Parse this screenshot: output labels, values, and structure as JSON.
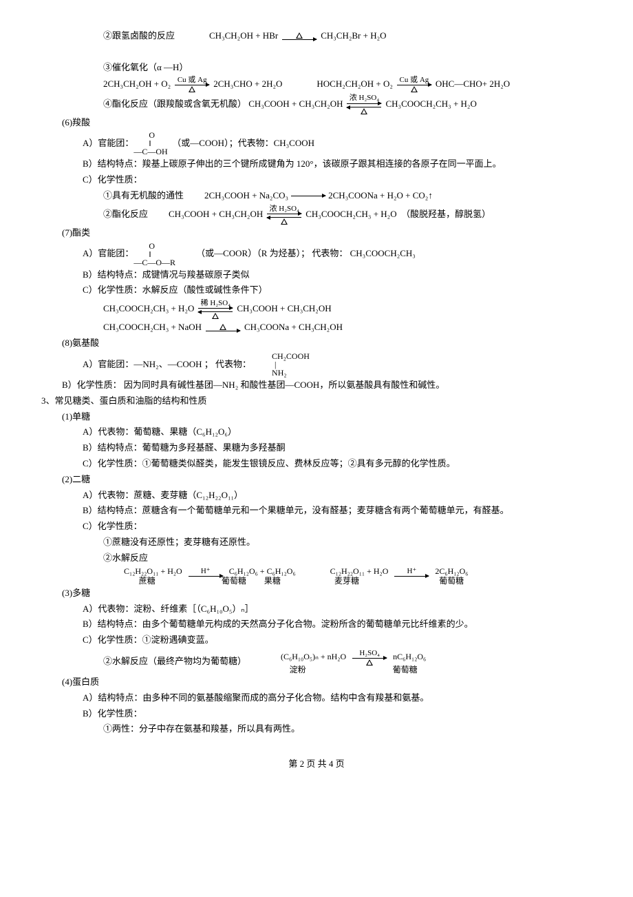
{
  "r1": {
    "label": "②跟氢卤酸的反应",
    "lhs": "CH₃CH₂OH + HBr",
    "rhs": "CH₃CH₂Br + H₂O"
  },
  "r2_label": "③催化氧化（α —H）",
  "r2a": {
    "lhs": "2CH₃CH₂OH + O₂",
    "cond": "Cu 或 Ag",
    "rhs": "2CH₃CHO + 2H₂O"
  },
  "r2b": {
    "lhs": "HOCH₂CH₂OH + O₂",
    "cond": "Cu 或 Ag",
    "rhs": "OHC—CHO+ 2H₂O"
  },
  "r3": {
    "label": "④酯化反应（跟羧酸或含氧无机酸）",
    "lhs": "CH₃COOH + CH₃CH₂OH",
    "cond": "浓 H₂SO₄",
    "rhs": "CH₃COOCH₂CH₃ + H₂O"
  },
  "s6": {
    "title": "(6)羧酸",
    "a_label": "A）官能团：",
    "a_struct_top": "O",
    "a_struct_mid": "‖",
    "a_struct_bot": "—C—OH",
    "a_rest": "（或—COOH）；代表物：CH₃COOH",
    "b": "B）结构特点：羧基上碳原子伸出的三个键所成键角为 120°，该碳原子跟其相连接的各原子在同一平面上。",
    "c": "C）化学性质：",
    "c1": {
      "label": "①具有无机酸的通性",
      "lhs": "2CH₃COOH + Na₂CO₃",
      "rhs": "2CH₃COONa + H₂O + CO₂↑"
    },
    "c2": {
      "label": "②酯化反应",
      "lhs": "CH₃COOH + CH₃CH₂OH",
      "cond": "浓 H₂SO₄",
      "rhs": "CH₃COOCH₂CH₃ + H₂O",
      "note": "（酸脱羟基，醇脱氢）"
    }
  },
  "s7": {
    "title": "(7)酯类",
    "a_label": "A）官能团：",
    "a_struct_top": "O",
    "a_struct_mid": "‖",
    "a_struct_bot": "—C—O—R",
    "a_rest": "（或—COOR）（R 为烃基）；  代表物：  CH₃COOCH₂CH₃",
    "b": "B）结构特点：成键情况与羧基碳原子类似",
    "c": "C）化学性质：水解反应（酸性或碱性条件下）",
    "c1": {
      "lhs": "CH₃COOCH₂CH₃ + H₂O",
      "cond": "稀 H₂SO₄",
      "rhs": "CH₃COOH + CH₃CH₂OH"
    },
    "c2": {
      "lhs": "CH₃COOCH₂CH₃ + NaOH",
      "rhs": "CH₃COONa + CH₃CH₂OH"
    }
  },
  "s8": {
    "title": "(8)氨基酸",
    "a_label": "A）官能团：—NH₂、—COOH ；  代表物：",
    "struct_top": "CH₂COOH",
    "struct_mid": "|",
    "struct_bot": "NH₂",
    "b": "B）化学性质： 因为同时具有碱性基团—NH₂ 和酸性基团—COOH，所以氨基酸具有酸性和碱性。"
  },
  "s3_title": "3、常见糖类、蛋白质和油脂的结构和性质",
  "sugar1": {
    "title": "(1)单糖",
    "a": "A）代表物：葡萄糖、果糖（C₆H₁₂O₆）",
    "b": "B）结构特点：葡萄糖为多羟基醛、果糖为多羟基酮",
    "c": "C）化学性质：①葡萄糖类似醛类，能发生银镜反应、费林反应等；②具有多元醇的化学性质。"
  },
  "sugar2": {
    "title": "(2)二糖",
    "a": "A）代表物：蔗糖、麦芽糖（C₁₂H₂₂O₁₁）",
    "b": "B）结构特点：蔗糖含有一个葡萄糖单元和一个果糖单元，没有醛基；麦芽糖含有两个葡萄糖单元，有醛基。",
    "c": "C）化学性质：",
    "c1": "①蔗糖没有还原性；麦芽糖有还原性。",
    "c2": "②水解反应",
    "eq1": {
      "lhs": "C₁₂H₂₂O₁₁ + H₂O",
      "cond": "H⁺",
      "rhs": "C₆H₁₂O₆ + C₆H₁₂O₆",
      "sub1": "蔗糖",
      "sub2": "葡萄糖",
      "sub3": "果糖"
    },
    "eq2": {
      "lhs": "C₁₂H₂₂O₁₁ + H₂O",
      "cond": "H⁺",
      "rhs": "2C₆H₁₂O₆",
      "sub1": "麦芽糖",
      "sub2": "葡萄糖"
    }
  },
  "sugar3": {
    "title": "(3)多糖",
    "a": "A）代表物：淀粉、纤维素［（C₆H₁₀O₅）ₙ］",
    "b": "B）结构特点：由多个葡萄糖单元构成的天然高分子化合物。淀粉所含的葡萄糖单元比纤维素的少。",
    "c": "C）化学性质：①淀粉遇碘变蓝。",
    "c2_label": "②水解反应（最终产物均为葡萄糖）",
    "eq": {
      "lhs": "(C₆H₁₀O₅)ₙ + nH₂O",
      "cond": "H₂SO₄",
      "rhs": "nC₆H₁₂O₆",
      "sub1": "淀粉",
      "sub2": "葡萄糖"
    }
  },
  "protein": {
    "title": "(4)蛋白质",
    "a": "A）结构特点：由多种不同的氨基酸缩聚而成的高分子化合物。结构中含有羧基和氨基。",
    "b": "B）化学性质：",
    "b1": "①两性：分子中存在氨基和羧基，所以具有两性。"
  },
  "footer": "第 2 页 共 4 页"
}
